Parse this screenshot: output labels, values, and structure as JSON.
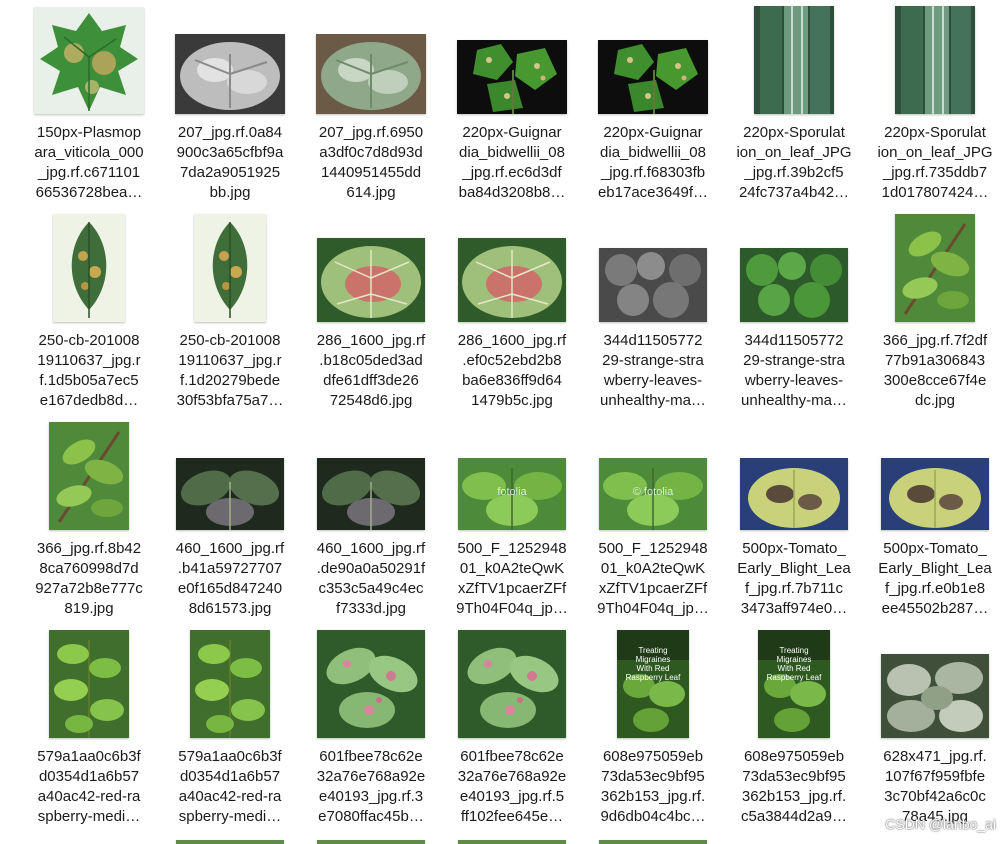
{
  "files": [
    {
      "name": "150px-Plasmopara_viticola_000_jpg.rf.c67110166536728bea…",
      "lines": [
        "150px-Plasmop",
        "ara_viticola_000",
        "_jpg.rf.c671101",
        "66536728bea…"
      ],
      "thumb": "grape-leaf-downy"
    },
    {
      "name": "207_jpg.rf.0a84900c3a65cfbf9a7da2a9051925bb.jpg",
      "lines": [
        "207_jpg.rf.0a84",
        "900c3a65cfbf9a",
        "7da2a9051925",
        "bb.jpg"
      ],
      "thumb": "squash-leaf-grayscale"
    },
    {
      "name": "207_jpg.rf.69503df0c7d8d93d1440951455dd614.jpg",
      "lines": [
        "207_jpg.rf.6950",
        "a3df0c7d8d93d",
        "1440951455dd",
        "614.jpg"
      ],
      "thumb": "squash-leaf-mildew"
    },
    {
      "name": "220px-Guignardia_bidwellii_08_jpg.rf.ec6d3dfba84d3208b8…",
      "lines": [
        "220px-Guignar",
        "dia_bidwellii_08",
        "_jpg.rf.ec6d3df",
        "ba84d3208b8…"
      ],
      "thumb": "grape-leaf-blackrot"
    },
    {
      "name": "220px-Guignardia_bidwellii_08_jpg.rf.f68303fbeb17ace3649f…",
      "lines": [
        "220px-Guignar",
        "dia_bidwellii_08",
        "_jpg.rf.f68303fb",
        "eb17ace3649f…"
      ],
      "thumb": "grape-leaf-blackrot"
    },
    {
      "name": "220px-Sporulation_on_leaf_JPG_jpg.rf.39b2cf524fc737a4b42…",
      "lines": [
        "220px-Sporulat",
        "ion_on_leaf_JPG",
        "_jpg.rf.39b2cf5",
        "24fc737a4b42…"
      ],
      "thumb": "corn-leaf-sporulation"
    },
    {
      "name": "220px-Sporulation_on_leaf_JPG_jpg.rf.735ddb71d017807424…",
      "lines": [
        "220px-Sporulat",
        "ion_on_leaf_JPG",
        "_jpg.rf.735ddb7",
        "1d017807424…"
      ],
      "thumb": "corn-leaf-sporulation"
    },
    {
      "name": "250-cb-20100819110637_jpg.rf.1d5b05a7ec5e167dedb8d…",
      "lines": [
        "250-cb-201008",
        "19110637_jpg.r",
        "f.1d5b05a7ec5",
        "e167dedb8d…"
      ],
      "thumb": "leaf-specimen"
    },
    {
      "name": "250-cb-20100819110637_jpg.rf.1d20279bede30f53bfa75a7…",
      "lines": [
        "250-cb-201008",
        "19110637_jpg.r",
        "f.1d20279bede",
        "30f53bfa75a7…"
      ],
      "thumb": "leaf-specimen"
    },
    {
      "name": "286_1600_jpg.rf.b18c05ded3addfe61dff3de2672548d6.jpg",
      "lines": [
        "286_1600_jpg.rf",
        ".b18c05ded3ad",
        "dfe61dff3de26",
        "72548d6.jpg"
      ],
      "thumb": "leaf-red-blotch"
    },
    {
      "name": "286_1600_jpg.rf.ef0c52ebd2b8ba6e836ff9d641479b5c.jpg",
      "lines": [
        "286_1600_jpg.rf",
        ".ef0c52ebd2b8",
        "ba6e836ff9d64",
        "1479b5c.jpg"
      ],
      "thumb": "leaf-red-blotch"
    },
    {
      "name": "344d1150577229-strange-strawberry-leaves-unhealthy-ma…",
      "lines": [
        "344d11505772",
        "29-strange-stra",
        "wberry-leaves-",
        "unhealthy-ma…"
      ],
      "thumb": "strawberry-grayscale"
    },
    {
      "name": "344d1150577229-strange-strawberry-leaves-unhealthy-ma…",
      "lines": [
        "344d11505772",
        "29-strange-stra",
        "wberry-leaves-",
        "unhealthy-ma…"
      ],
      "thumb": "strawberry-leaves"
    },
    {
      "name": "366_jpg.rf.7f2df77b91a306843300e8cce67f4edc.jpg",
      "lines": [
        "366_jpg.rf.7f2df",
        "77b91a306843",
        "300e8cce67f4e",
        "dc.jpg"
      ],
      "thumb": "branch-leaves"
    },
    {
      "name": "366_jpg.rf.8b428ca760998d7d927a72b8e777c819.jpg",
      "lines": [
        "366_jpg.rf.8b42",
        "8ca760998d7d",
        "927a72b8e777c",
        "819.jpg"
      ],
      "thumb": "branch-leaves"
    },
    {
      "name": "460_1600_jpg.rf.b41a59727707e0f165d8472408d61573.jpg",
      "lines": [
        "460_1600_jpg.rf",
        ".b41a59727707",
        "e0f165d847240",
        "8d61573.jpg"
      ],
      "thumb": "potato-blight-dark"
    },
    {
      "name": "460_1600_jpg.rf.de90a0a50291fc353c5a49c4ecf7333d.jpg",
      "lines": [
        "460_1600_jpg.rf",
        ".de90a0a50291f",
        "c353c5a49c4ec",
        "f7333d.jpg"
      ],
      "thumb": "potato-blight-dark"
    },
    {
      "name": "500_F_125294801_k0A2teQwKxZfTV1pcaerZFf9Th04F04q_jp…",
      "lines": [
        "500_F_1252948",
        "01_k0A2teQwK",
        "xZfTV1pcaerZFf",
        "9Th04F04q_jp…"
      ],
      "thumb": "stock-leaves",
      "wm": "fotolia"
    },
    {
      "name": "500_F_125294801_k0A2teQwKxZfTV1pcaerZFf9Th04F04q_jp…",
      "lines": [
        "500_F_1252948",
        "01_k0A2teQwK",
        "xZfTV1pcaerZFf",
        "9Th04F04q_jp…"
      ],
      "thumb": "stock-leaves",
      "wm": "© fotolia"
    },
    {
      "name": "500px-Tomato_Early_Blight_Leaf_jpg.rf.7b711c3473aff974e0…",
      "lines": [
        "500px-Tomato_",
        "Early_Blight_Lea",
        "f_jpg.rf.7b711c",
        "3473aff974e0…"
      ],
      "thumb": "tomato-early-blight"
    },
    {
      "name": "500px-Tomato_Early_Blight_Leaf_jpg.rf.e0b1e8ee45502b287…",
      "lines": [
        "500px-Tomato_",
        "Early_Blight_Lea",
        "f_jpg.rf.e0b1e8",
        "ee45502b287…"
      ],
      "thumb": "tomato-early-blight"
    },
    {
      "name": "579a1aa0c6b3fd0354d1a6b57a40ac42-red-raspberry-medi…",
      "lines": [
        "579a1aa0c6b3f",
        "d0354d1a6b57",
        "a40ac42-red-ra",
        "spberry-medi…"
      ],
      "thumb": "raspberry-plant"
    },
    {
      "name": "579a1aa0c6b3fd0354d1a6b57a40ac42-red-raspberry-medi…",
      "lines": [
        "579a1aa0c6b3f",
        "d0354d1a6b57",
        "a40ac42-red-ra",
        "spberry-medi…"
      ],
      "thumb": "raspberry-plant"
    },
    {
      "name": "601fbee78c62e32a76e768a92ee40193_jpg.rf.3e7080ffac45b…",
      "lines": [
        "601fbee78c62e",
        "32a76e768a92e",
        "e40193_jpg.rf.3",
        "e7080ffac45b…"
      ],
      "thumb": "leaf-pink-spots"
    },
    {
      "name": "601fbee78c62e32a76e768a92ee40193_jpg.rf.5ff102fee645e…",
      "lines": [
        "601fbee78c62e",
        "32a76e768a92e",
        "e40193_jpg.rf.5",
        "ff102fee645e…"
      ],
      "thumb": "leaf-pink-spots"
    },
    {
      "name": "608e975059eb73da53ec9bf95362b153_jpg.rf.9d6db04c4bc…",
      "lines": [
        "608e975059eb",
        "73da53ec9bf95",
        "362b153_jpg.rf.",
        "9d6db04c4bc…"
      ],
      "thumb": "raspberry-migraine",
      "overlay": [
        "Treating Migraines",
        "With Red Raspberry Leaf"
      ]
    },
    {
      "name": "608e975059eb73da53ec9bf95362b153_jpg.rf.c5a3844d2a9…",
      "lines": [
        "608e975059eb",
        "73da53ec9bf95",
        "362b153_jpg.rf.",
        "c5a3844d2a9…"
      ],
      "thumb": "raspberry-migraine",
      "overlay": [
        "Treating Migraines",
        "With Red Raspberry Leaf"
      ]
    },
    {
      "name": "628x471_jpg.rf.107f67f959fbfe3c70bf42a6c0c78a45.jpg",
      "lines": [
        "628x471_jpg.rf.",
        "107f67f959fbfe",
        "3c70bf42a6c0c",
        "78a45.jpg"
      ],
      "thumb": "ivy-mildew"
    }
  ],
  "watermark": "CSDN @lanbo_ai"
}
